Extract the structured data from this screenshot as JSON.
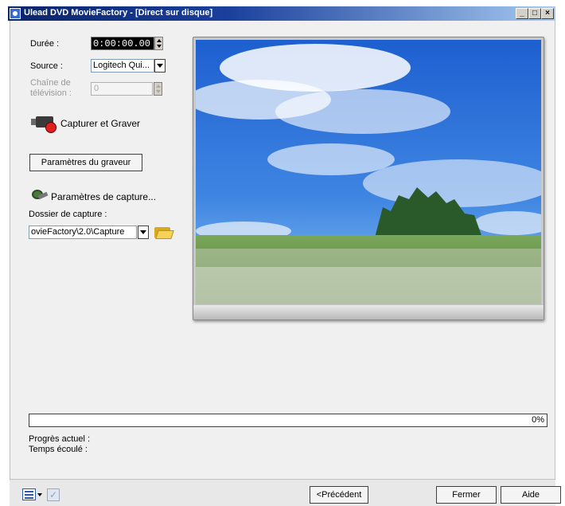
{
  "window": {
    "title": "Ulead DVD MovieFactory - [Direct sur disque]",
    "minimize": "_",
    "maximize": "□",
    "close": "×"
  },
  "controls": {
    "duration_label": "Durée :",
    "duration_value": "0:00:00.00",
    "source_label": "Source :",
    "source_value": "Logitech Qui...",
    "tv_channel_label_line1": "Chaîne de",
    "tv_channel_label_line2": "télévision :",
    "tv_channel_value": "0",
    "capture_burn_label": "Capturer et Graver",
    "burner_params_button": "Paramètres du graveur",
    "capture_params_label": "Paramètres de capture...",
    "capture_folder_label": "Dossier de capture :",
    "capture_folder_value": "ovieFactory\\2.0\\Capture"
  },
  "progress": {
    "percent_text": "0%",
    "fraction": 0,
    "current_label": "Progrès actuel :",
    "elapsed_label": "Temps écoulé :"
  },
  "footer": {
    "previous_button": "<Précédent",
    "close_button": "Fermer",
    "help_button": "Aide"
  },
  "colors": {
    "title_bar": "#0a246a",
    "progress_fill": "#316ac5",
    "record_red": "#e02020",
    "folder_yellow": "#f6d25a"
  }
}
